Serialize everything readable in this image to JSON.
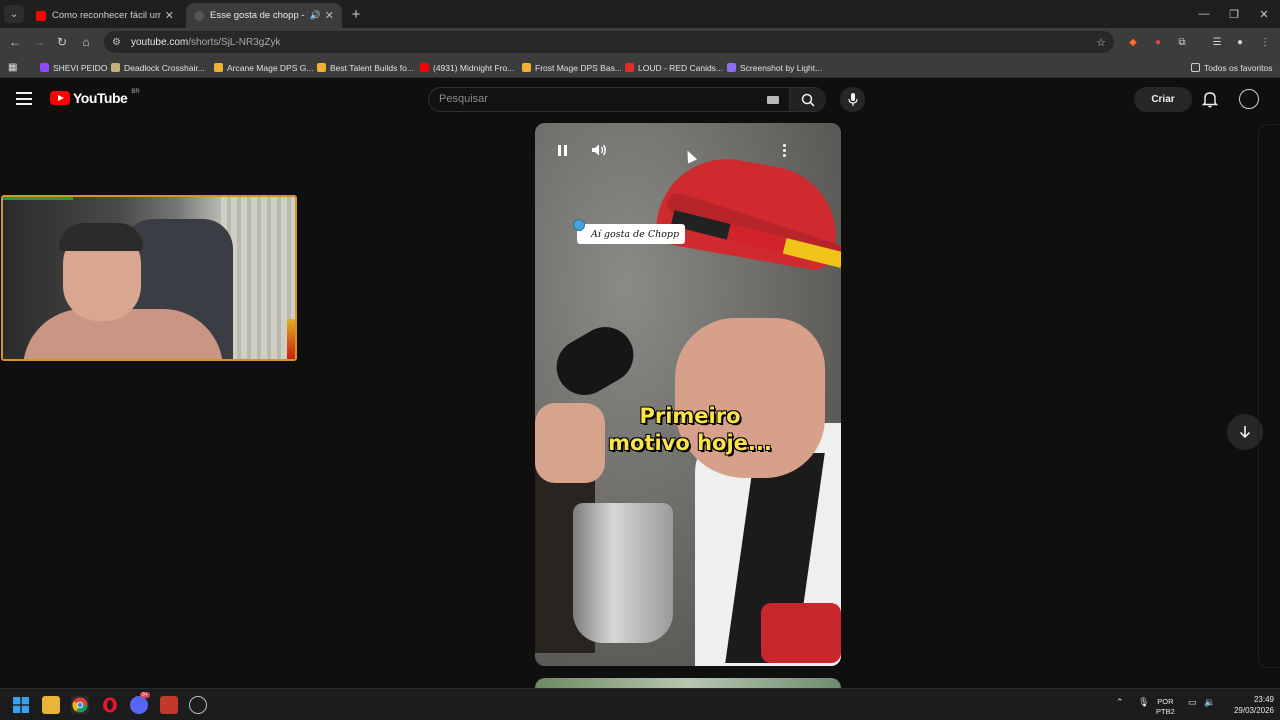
{
  "browser": {
    "tabs": [
      {
        "title": "Como reconhecer fácil uma do",
        "active": false,
        "favicon_color": "#ff0000"
      },
      {
        "title": "Esse gosta de chopp - YouT",
        "active": true,
        "favicon_color": "#2b2b2b"
      }
    ],
    "url_host": "youtube.com",
    "url_path": "/shorts/SjL-NR3gZyk",
    "bookmarks": [
      {
        "label": "SHEVI PEIDO",
        "color": "#9146ff"
      },
      {
        "label": "Deadlock Crosshair...",
        "color": "#c9b27a"
      },
      {
        "label": "Arcane Mage DPS G...",
        "color": "#f0b132"
      },
      {
        "label": "Best Talent Builds fo...",
        "color": "#f0b132"
      },
      {
        "label": "(4931) Midnight Fro...",
        "color": "#ff0000"
      },
      {
        "label": "Frost Mage DPS Bas...",
        "color": "#f0b132"
      },
      {
        "label": "LOUD - RED Canids...",
        "color": "#e02d2d"
      },
      {
        "label": "Screenshot by Light...",
        "color": "#8e6cf0"
      }
    ],
    "all_bookmarks_label": "Todos os favoritos"
  },
  "youtube": {
    "logo_text": "YouTube",
    "country_code": "BR",
    "search_placeholder": "Pesquisar",
    "create_label": "Criar"
  },
  "short": {
    "sticker_text": "Aí gosta de Chopp",
    "caption_line1": "Primeiro",
    "caption_line2": "motivo hoje..."
  },
  "taskbar": {
    "lang_top": "POR",
    "lang_bottom": "PTB2",
    "time": "23:49",
    "date": "29/03/2026",
    "discord_badge": "9+"
  },
  "colors": {
    "webcam_border": "#d49527",
    "youtube_red": "#ff0000",
    "caption_yellow": "#f9e44c"
  }
}
